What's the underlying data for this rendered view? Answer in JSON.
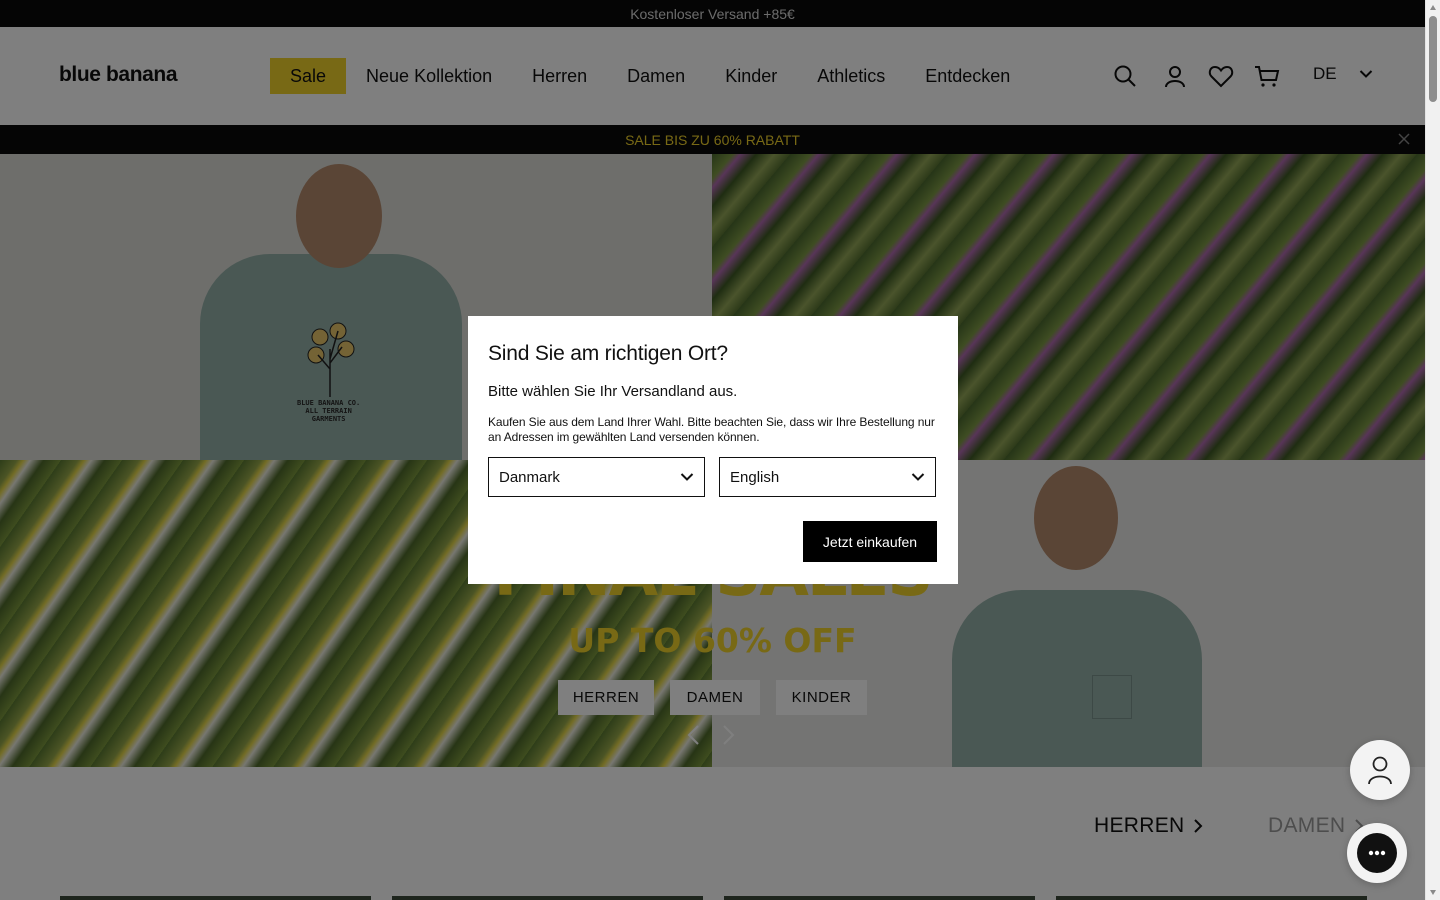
{
  "topbar": {
    "text": "Kostenloser Versand +85€"
  },
  "header": {
    "logo": "blue banana",
    "nav": [
      "Sale",
      "Neue Kollektion",
      "Herren",
      "Damen",
      "Kinder",
      "Athletics",
      "Entdecken"
    ],
    "language": "DE",
    "icons": [
      "search-icon",
      "account-icon",
      "heart-icon",
      "cart-icon",
      "chevron-down-icon"
    ]
  },
  "promo": {
    "text": "SALE BIS ZU 60% RABATT"
  },
  "hero": {
    "print_text": [
      "BLUE BANANA CO.",
      "ALL TERRAIN",
      "GARMENTS"
    ],
    "headline": "FINAL SALES",
    "subline": "UP TO 60% OFF",
    "buttons": [
      "HERREN",
      "DAMEN",
      "KINDER"
    ]
  },
  "category_tabs": [
    "HERREN",
    "DAMEN"
  ],
  "modal": {
    "title": "Sind Sie am richtigen Ort?",
    "subtitle": "Bitte wählen Sie Ihr Versandland aus.",
    "text": "Kaufen Sie aus dem Land Ihrer Wahl. Bitte beachten Sie, dass wir Ihre Bestellung nur an Adressen im gewählten Land versenden können.",
    "country": "Danmark",
    "language": "English",
    "button": "Jetzt einkaufen"
  },
  "colors": {
    "accent": "#f0d22a",
    "dark": "#0a0a0a",
    "overlay": "rgba(0,0,0,0.5)"
  }
}
